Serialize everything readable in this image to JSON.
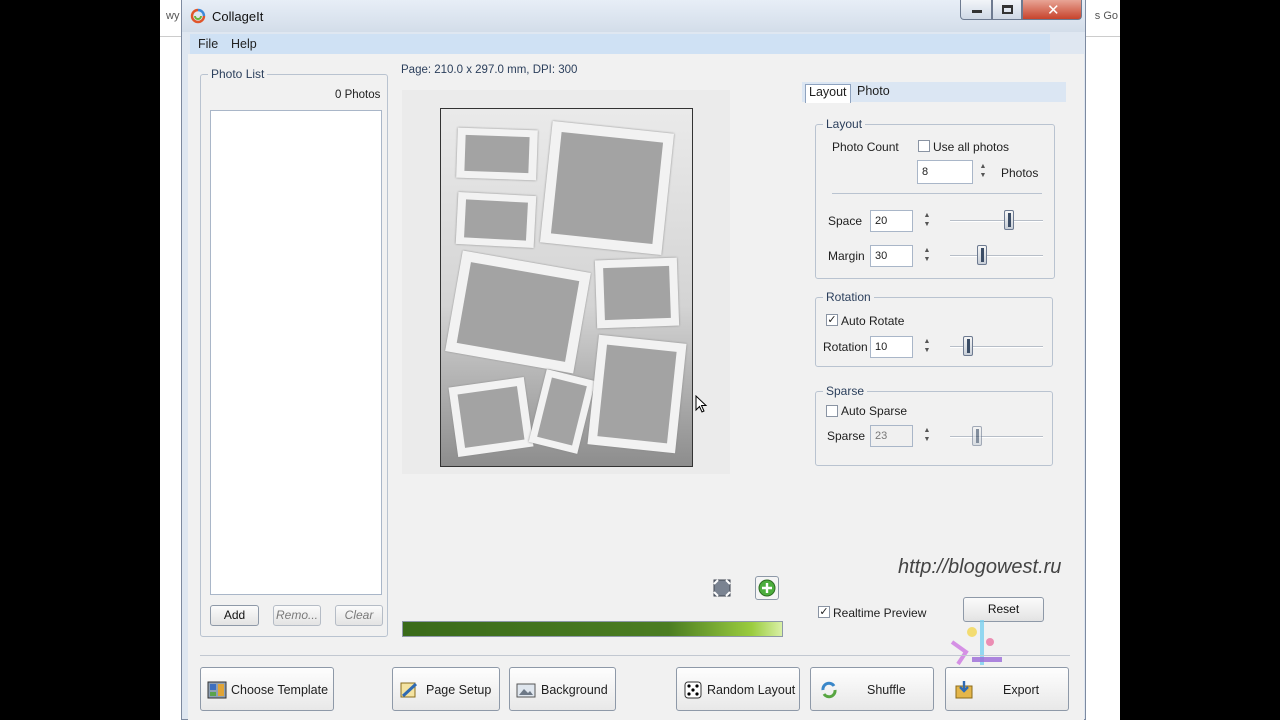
{
  "background": {
    "left_text": "wy",
    "right_text": "s Go"
  },
  "window": {
    "title": "CollageIt"
  },
  "menu": {
    "items": [
      "File",
      "Help"
    ]
  },
  "photo_list": {
    "label": "Photo List",
    "count": "0 Photos",
    "buttons": {
      "add": "Add",
      "remove": "Remo...",
      "clear": "Clear"
    }
  },
  "page_info": "Page: 210.0 x 297.0 mm, DPI: 300",
  "tabs": [
    "Layout",
    "Photo"
  ],
  "layout_group": {
    "label": "Layout",
    "photo_count_label": "Photo Count",
    "use_all_label": "Use all photos",
    "use_all_checked": false,
    "photo_count_value": "8",
    "photos_unit": "Photos",
    "space_label": "Space",
    "space_value": "20",
    "space_level": 0.65,
    "margin_label": "Margin",
    "margin_value": "30",
    "margin_level": 0.33
  },
  "rotation_group": {
    "label": "Rotation",
    "auto_rotate_label": "Auto Rotate",
    "auto_rotate_checked": true,
    "rotation_label": "Rotation",
    "rotation_value": "10",
    "rotation_level": 0.16
  },
  "sparse_group": {
    "label": "Sparse",
    "auto_sparse_label": "Auto Sparse",
    "auto_sparse_checked": false,
    "sparse_label": "Sparse",
    "sparse_value": "23",
    "sparse_level": 0.27
  },
  "realtime_preview": {
    "label": "Realtime Preview",
    "checked": true
  },
  "reset_label": "Reset",
  "watermark": "http://blogowest.ru",
  "progress": 1.0,
  "bottom_buttons": {
    "choose_template": "Choose Template",
    "page_setup": "Page Setup",
    "background": "Background",
    "random_layout": "Random Layout",
    "shuffle": "Shuffle",
    "export": "Export"
  },
  "colors": {
    "accent": "#cfe1f4",
    "progress": "#4b7d22",
    "close": "#c7432c"
  }
}
